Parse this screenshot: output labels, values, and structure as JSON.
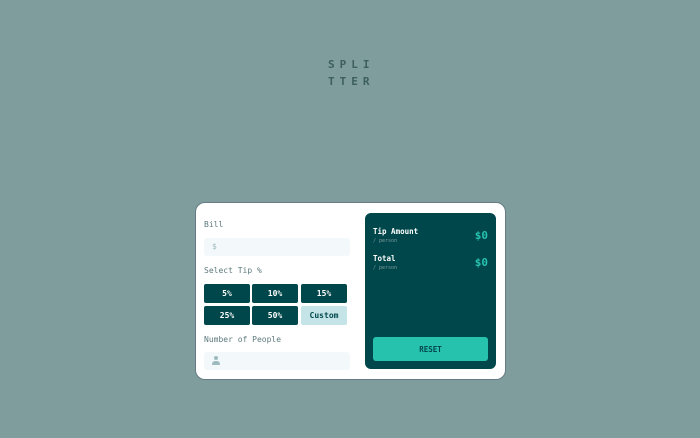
{
  "logo": {
    "line1": "SPLI",
    "line2": "TTER"
  },
  "bill": {
    "label": "Bill",
    "icon": "dollar-icon",
    "currency_symbol": "$",
    "value": ""
  },
  "tip": {
    "label": "Select Tip %",
    "options": [
      "5%",
      "10%",
      "15%",
      "25%",
      "50%"
    ],
    "custom_label": "Custom"
  },
  "people": {
    "label": "Number of People",
    "icon": "person-icon",
    "value": ""
  },
  "results": {
    "tip_amount": {
      "label": "Tip Amount",
      "sub": "/ person",
      "value": "$0"
    },
    "total": {
      "label": "Total",
      "sub": "/ person",
      "value": "$0"
    },
    "reset_label": "RESET"
  },
  "colors": {
    "background": "#7f9d9c",
    "dark_cyan": "#00474b",
    "strong_cyan": "#26c2ae",
    "light_cyan": "#c5e4e7",
    "input_bg": "#f3f8fb"
  }
}
